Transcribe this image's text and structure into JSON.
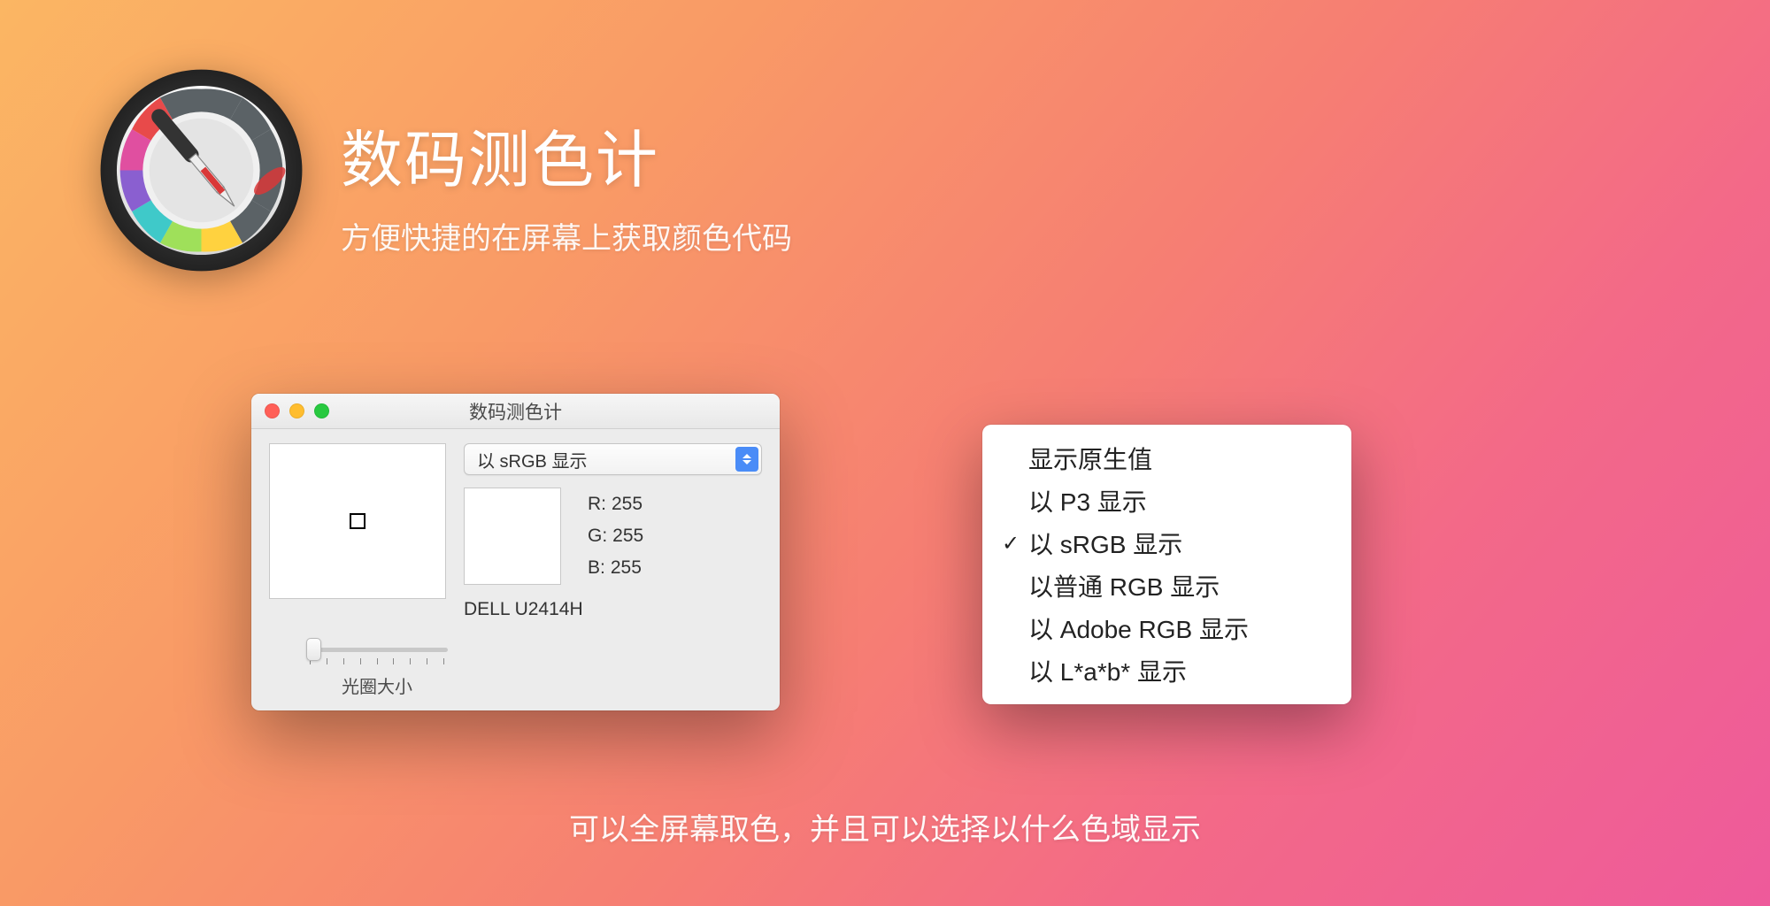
{
  "hero": {
    "title": "数码测色计",
    "subtitle": "方便快捷的在屏幕上获取颜色代码"
  },
  "window": {
    "title": "数码测色计",
    "dropdown_selected": "以 sRGB 显示",
    "rgb": {
      "r_label": "R:",
      "r_value": "255",
      "g_label": "G:",
      "g_value": "255",
      "b_label": "B:",
      "b_value": "255"
    },
    "monitor": "DELL U2414H",
    "slider_label": "光圈大小"
  },
  "menu": {
    "items": [
      {
        "label": "显示原生值",
        "checked": false
      },
      {
        "label": "以 P3 显示",
        "checked": false
      },
      {
        "label": "以 sRGB 显示",
        "checked": true
      },
      {
        "label": "以普通 RGB 显示",
        "checked": false
      },
      {
        "label": "以 Adobe RGB 显示",
        "checked": false
      },
      {
        "label": "以 L*a*b* 显示",
        "checked": false
      }
    ]
  },
  "caption": "可以全屏幕取色，并且可以选择以什么色域显示"
}
